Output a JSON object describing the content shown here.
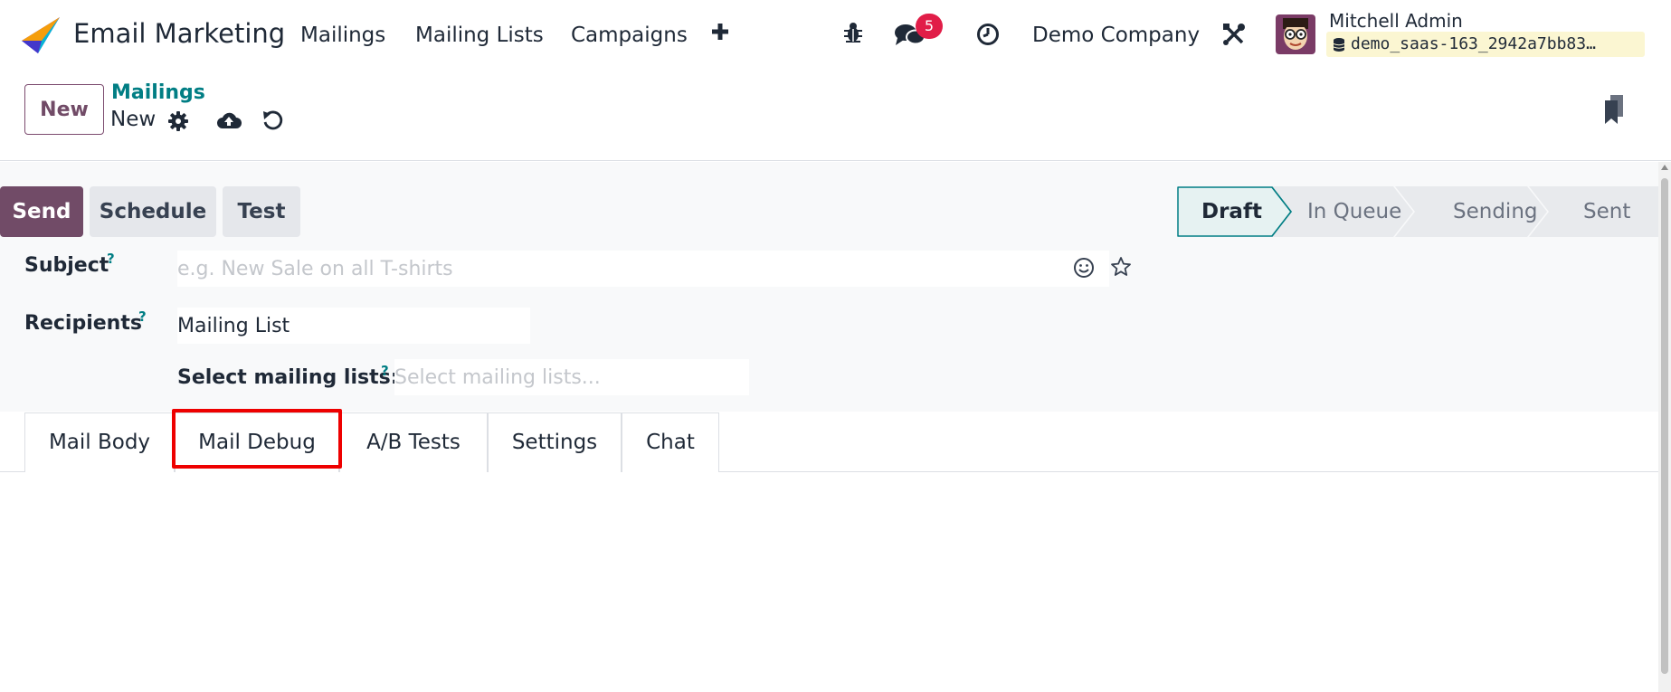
{
  "navbar": {
    "app_name": "Email Marketing",
    "menu": [
      "Mailings",
      "Mailing Lists",
      "Campaigns"
    ],
    "add_icon": "plus-icon",
    "debug_icon": "bug-icon",
    "messages_icon": "chat-bubbles-icon",
    "messages_count": "5",
    "activity_icon": "clock-icon",
    "company": "Demo Company",
    "settings_icon": "tools-icon",
    "user_name": "Mitchell Admin",
    "database": "demo_saas-163_2942a7bb83…"
  },
  "control_panel": {
    "new_label": "New",
    "breadcrumb_parent": "Mailings",
    "breadcrumb_current": "New",
    "gear_icon": "gear-icon",
    "save_icon": "cloud-upload-icon",
    "discard_icon": "undo-icon",
    "bookmark_icon": "bookmark-icon"
  },
  "statusbar": {
    "buttons": [
      "Send",
      "Schedule",
      "Test"
    ],
    "stages": [
      "Draft",
      "In Queue",
      "Sending",
      "Sent"
    ],
    "active_stage": "Draft"
  },
  "form": {
    "subject_label": "Subject",
    "subject_placeholder": "e.g. New Sale on all T-shirts",
    "recipients_label": "Recipients",
    "recipients_value": "Mailing List",
    "lists_label": "Select mailing lists:",
    "lists_placeholder": "Select mailing lists...",
    "help_mark": "?"
  },
  "tabs": [
    "Mail Body",
    "Mail Debug",
    "A/B Tests",
    "Settings",
    "Chat"
  ],
  "highlighted_tab": "Mail Debug",
  "colors": {
    "primary": "#714b67",
    "link": "#017e84",
    "highlight": "#ee0000",
    "badge": "#e11d48"
  }
}
